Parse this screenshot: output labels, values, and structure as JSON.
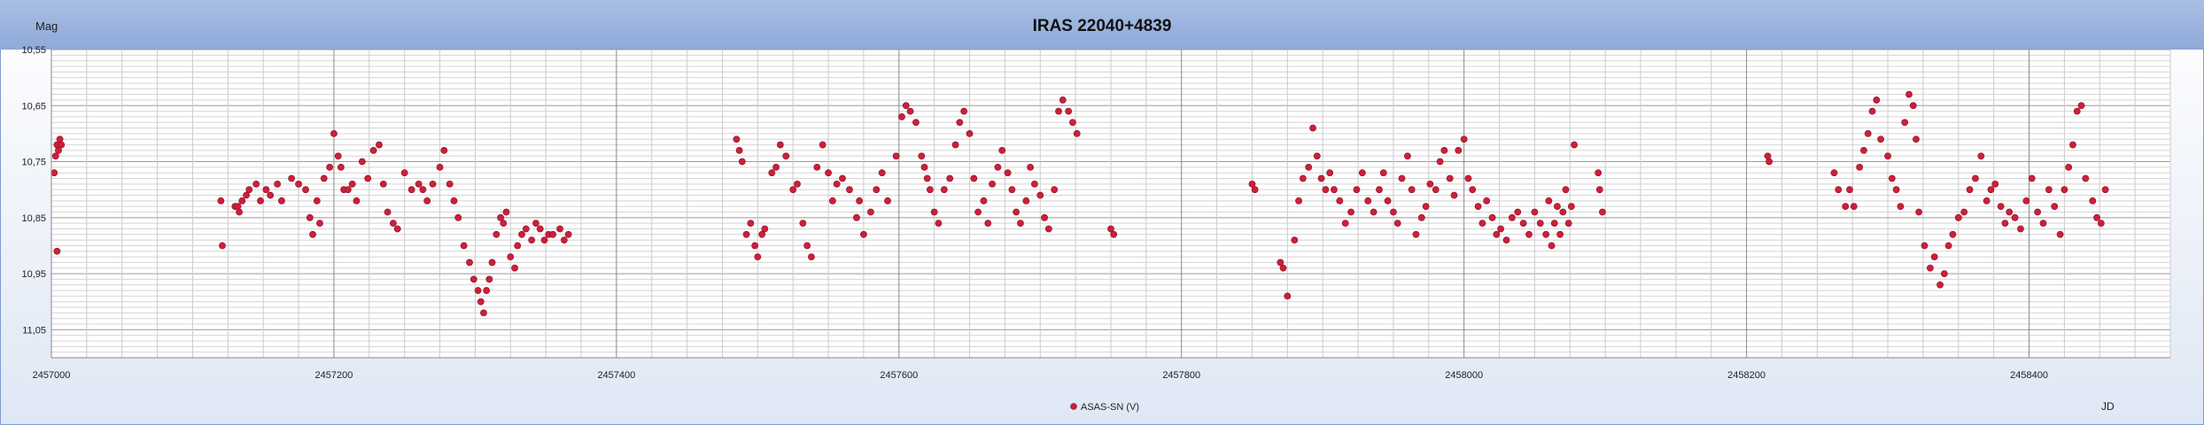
{
  "chart_data": {
    "type": "scatter",
    "title": "IRAS 22040+4839",
    "ylabel": "Mag",
    "xlabel": "JD",
    "xlim": [
      2457000,
      2458500
    ],
    "ylim": [
      11.1,
      10.55
    ],
    "y_inverted": true,
    "x_ticks": [
      "2457000",
      "2457200",
      "2457400",
      "2457600",
      "2457800",
      "2458000",
      "2458200",
      "2458400"
    ],
    "x_tick_values": [
      2457000,
      2457200,
      2457400,
      2457600,
      2457800,
      2458000,
      2458200,
      2458400
    ],
    "y_ticks": [
      "10,55",
      "10,65",
      "10,75",
      "10,85",
      "10,95",
      "11,05"
    ],
    "y_tick_values": [
      10.55,
      10.65,
      10.75,
      10.85,
      10.95,
      11.05
    ],
    "grid": true,
    "legend_position": "bottom-center",
    "series": [
      {
        "name": "ASAS-SN (V)",
        "color": "#cc1f3a",
        "x": [
          2457002,
          2457003,
          2457004,
          2457005,
          2457006,
          2457007,
          2457004,
          2457120,
          2457121,
          2457130,
          2457133,
          2457135,
          2457138,
          2457140,
          2457132,
          2457145,
          2457148,
          2457152,
          2457155,
          2457160,
          2457163,
          2457170,
          2457175,
          2457180,
          2457183,
          2457185,
          2457188,
          2457190,
          2457193,
          2457197,
          2457200,
          2457203,
          2457205,
          2457207,
          2457210,
          2457213,
          2457216,
          2457220,
          2457224,
          2457228,
          2457232,
          2457235,
          2457238,
          2457242,
          2457245,
          2457250,
          2457255,
          2457260,
          2457263,
          2457266,
          2457270,
          2457275,
          2457278,
          2457282,
          2457285,
          2457288,
          2457292,
          2457296,
          2457299,
          2457302,
          2457304,
          2457306,
          2457308,
          2457310,
          2457312,
          2457315,
          2457318,
          2457320,
          2457322,
          2457325,
          2457328,
          2457330,
          2457333,
          2457336,
          2457340,
          2457343,
          2457346,
          2457349,
          2457352,
          2457355,
          2457360,
          2457363,
          2457366,
          2457485,
          2457487,
          2457489,
          2457492,
          2457495,
          2457498,
          2457500,
          2457503,
          2457505,
          2457510,
          2457513,
          2457516,
          2457520,
          2457525,
          2457528,
          2457532,
          2457535,
          2457538,
          2457542,
          2457546,
          2457550,
          2457553,
          2457556,
          2457560,
          2457565,
          2457570,
          2457572,
          2457575,
          2457580,
          2457584,
          2457588,
          2457592,
          2457598,
          2457602,
          2457605,
          2457608,
          2457612,
          2457616,
          2457618,
          2457620,
          2457622,
          2457625,
          2457628,
          2457632,
          2457636,
          2457640,
          2457643,
          2457646,
          2457650,
          2457653,
          2457656,
          2457660,
          2457663,
          2457666,
          2457670,
          2457673,
          2457677,
          2457680,
          2457683,
          2457686,
          2457690,
          2457693,
          2457696,
          2457700,
          2457703,
          2457706,
          2457710,
          2457713,
          2457716,
          2457720,
          2457723,
          2457726,
          2457750,
          2457752,
          2457850,
          2457852,
          2457870,
          2457872,
          2457875,
          2457880,
          2457883,
          2457886,
          2457890,
          2457893,
          2457896,
          2457899,
          2457902,
          2457905,
          2457908,
          2457912,
          2457916,
          2457920,
          2457924,
          2457928,
          2457932,
          2457936,
          2457940,
          2457943,
          2457946,
          2457950,
          2457953,
          2457956,
          2457960,
          2457963,
          2457966,
          2457970,
          2457973,
          2457976,
          2457980,
          2457983,
          2457986,
          2457990,
          2457993,
          2457996,
          2458000,
          2458003,
          2458006,
          2458010,
          2458013,
          2458016,
          2458020,
          2458023,
          2458026,
          2458030,
          2458034,
          2458038,
          2458042,
          2458046,
          2458050,
          2458054,
          2458058,
          2458060,
          2458062,
          2458064,
          2458066,
          2458068,
          2458070,
          2458072,
          2458074,
          2458076,
          2458078,
          2458095,
          2458096,
          2458098,
          2458215,
          2458216,
          2458262,
          2458265,
          2458270,
          2458273,
          2458276,
          2458280,
          2458283,
          2458286,
          2458289,
          2458292,
          2458295,
          2458300,
          2458303,
          2458306,
          2458309,
          2458312,
          2458315,
          2458318,
          2458320,
          2458322,
          2458326,
          2458330,
          2458333,
          2458337,
          2458340,
          2458343,
          2458346,
          2458350,
          2458354,
          2458358,
          2458362,
          2458366,
          2458370,
          2458373,
          2458376,
          2458380,
          2458383,
          2458386,
          2458390,
          2458394,
          2458398,
          2458402,
          2458406,
          2458410,
          2458414,
          2458418,
          2458422,
          2458425,
          2458428,
          2458431,
          2458434,
          2458437,
          2458440,
          2458445,
          2458448,
          2458451,
          2458454
        ],
        "y": [
          10.77,
          10.74,
          10.72,
          10.73,
          10.71,
          10.72,
          10.91,
          10.82,
          10.9,
          10.83,
          10.84,
          10.82,
          10.81,
          10.8,
          10.83,
          10.79,
          10.82,
          10.8,
          10.81,
          10.79,
          10.82,
          10.78,
          10.79,
          10.8,
          10.85,
          10.88,
          10.82,
          10.86,
          10.78,
          10.76,
          10.7,
          10.74,
          10.76,
          10.8,
          10.8,
          10.79,
          10.82,
          10.75,
          10.78,
          10.73,
          10.72,
          10.79,
          10.84,
          10.86,
          10.87,
          10.77,
          10.8,
          10.79,
          10.8,
          10.82,
          10.79,
          10.76,
          10.73,
          10.79,
          10.82,
          10.85,
          10.9,
          10.93,
          10.96,
          10.98,
          11.0,
          11.02,
          10.98,
          10.96,
          10.93,
          10.88,
          10.85,
          10.86,
          10.84,
          10.92,
          10.94,
          10.9,
          10.88,
          10.87,
          10.89,
          10.86,
          10.87,
          10.89,
          10.88,
          10.88,
          10.87,
          10.89,
          10.88,
          10.71,
          10.73,
          10.75,
          10.88,
          10.86,
          10.9,
          10.92,
          10.88,
          10.87,
          10.77,
          10.76,
          10.72,
          10.74,
          10.8,
          10.79,
          10.86,
          10.9,
          10.92,
          10.76,
          10.72,
          10.77,
          10.82,
          10.79,
          10.78,
          10.8,
          10.85,
          10.82,
          10.88,
          10.84,
          10.8,
          10.77,
          10.82,
          10.74,
          10.67,
          10.65,
          10.66,
          10.68,
          10.74,
          10.76,
          10.78,
          10.8,
          10.84,
          10.86,
          10.8,
          10.78,
          10.72,
          10.68,
          10.66,
          10.7,
          10.78,
          10.84,
          10.82,
          10.86,
          10.79,
          10.76,
          10.73,
          10.77,
          10.8,
          10.84,
          10.86,
          10.82,
          10.76,
          10.79,
          10.81,
          10.85,
          10.87,
          10.8,
          10.66,
          10.64,
          10.66,
          10.68,
          10.7,
          10.87,
          10.88,
          10.79,
          10.8,
          10.93,
          10.94,
          10.99,
          10.89,
          10.82,
          10.78,
          10.76,
          10.69,
          10.74,
          10.78,
          10.8,
          10.77,
          10.8,
          10.82,
          10.86,
          10.84,
          10.8,
          10.77,
          10.82,
          10.84,
          10.8,
          10.77,
          10.82,
          10.84,
          10.86,
          10.78,
          10.74,
          10.8,
          10.88,
          10.85,
          10.83,
          10.79,
          10.8,
          10.75,
          10.73,
          10.78,
          10.81,
          10.73,
          10.71,
          10.78,
          10.8,
          10.83,
          10.86,
          10.82,
          10.85,
          10.88,
          10.87,
          10.89,
          10.85,
          10.84,
          10.86,
          10.88,
          10.84,
          10.86,
          10.88,
          10.82,
          10.9,
          10.86,
          10.83,
          10.88,
          10.84,
          10.8,
          10.86,
          10.83,
          10.72,
          10.77,
          10.8,
          10.84,
          10.74,
          10.75,
          10.77,
          10.8,
          10.83,
          10.8,
          10.83,
          10.76,
          10.73,
          10.7,
          10.66,
          10.64,
          10.71,
          10.74,
          10.78,
          10.8,
          10.83,
          10.68,
          10.63,
          10.65,
          10.71,
          10.84,
          10.9,
          10.94,
          10.92,
          10.97,
          10.95,
          10.9,
          10.88,
          10.85,
          10.84,
          10.8,
          10.78,
          10.74,
          10.82,
          10.8,
          10.79,
          10.83,
          10.86,
          10.84,
          10.85,
          10.87,
          10.82,
          10.78,
          10.84,
          10.86,
          10.8,
          10.83,
          10.88,
          10.8,
          10.76,
          10.72,
          10.66,
          10.65,
          10.78,
          10.82,
          10.85,
          10.86,
          10.8
        ]
      }
    ]
  },
  "legend_label": "ASAS-SN (V)"
}
